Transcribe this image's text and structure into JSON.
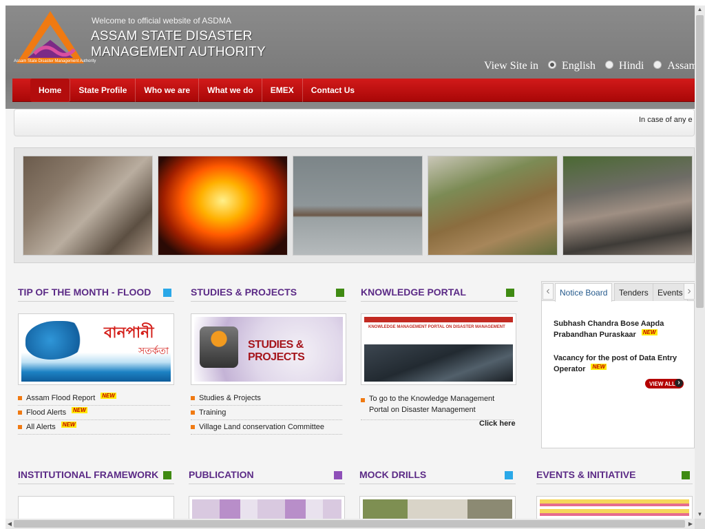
{
  "header": {
    "welcome": "Welcome to official website of ASDMA",
    "title_line1": "ASSAM STATE DISASTER",
    "title_line2": "MANAGEMENT AUTHORITY",
    "logo_caption": "Assam State Disaster Management Authority",
    "language": {
      "label": "View Site in",
      "options": [
        "English",
        "Hindi",
        "Assamese"
      ],
      "selected": "English"
    }
  },
  "nav": {
    "items": [
      "Home",
      "State Profile",
      "Who we are",
      "What we do",
      "EMEX",
      "Contact Us"
    ]
  },
  "marquee": {
    "text": "In case of any e"
  },
  "slider": {
    "photos": [
      "earthquake-rubble",
      "fire",
      "flood-houses",
      "landslide",
      "storm-damage"
    ]
  },
  "sections": {
    "tip": {
      "title": "TIP OF THE MONTH - FLOOD",
      "thumb_text": "বানপানী",
      "thumb_sub": "সতৰ্কতা",
      "items": [
        "Assam Flood Report",
        "Flood Alerts",
        "All Alerts"
      ],
      "new_label": "NEW"
    },
    "studies": {
      "title": "STUDIES & PROJECTS",
      "thumb_text": "STUDIES & PROJECTS",
      "items": [
        "Studies & Projects",
        "Training",
        "Village Land conservation Committee"
      ]
    },
    "knowledge": {
      "title": "KNOWLEDGE PORTAL",
      "thumb_text": "KNOWLEDGE MANAGEMENT PORTAL ON DISASTER MANAGEMENT",
      "text": "To go to the Knowledge Management Portal on Disaster Management",
      "link": "Click here"
    },
    "notice": {
      "tabs": [
        "Notice Board",
        "Tenders",
        "Events"
      ],
      "items": [
        "Subhash Chandra Bose Aapda Prabandhan Puraskaar",
        "Vacancy for the post of Data Entry Operator"
      ],
      "view_all": "VIEW ALL"
    },
    "bottom": {
      "institutional": "INSTITUTIONAL FRAMEWORK",
      "publication": "PUBLICATION",
      "mock": "MOCK DRILLS",
      "events": "EVENTS & INITIATIVE"
    }
  },
  "colors": {
    "accent_purple": "#5b2a86",
    "nav_red": "#c21212",
    "sq_blue": "#2aa8e8",
    "sq_green": "#3f8a12",
    "sq_purple": "#8e4fb8",
    "bullet_orange": "#f07a12"
  }
}
